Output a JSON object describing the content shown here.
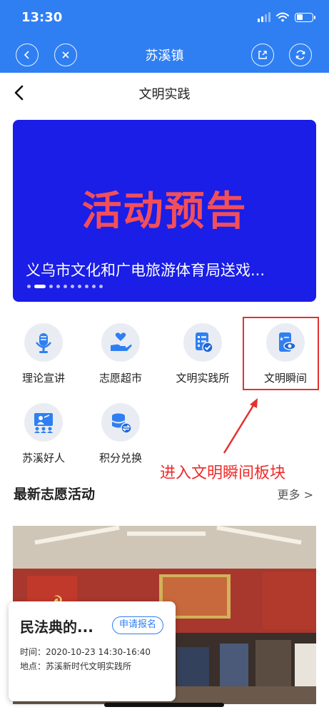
{
  "status_bar": {
    "time": "13:30"
  },
  "app_bar": {
    "title": "苏溪镇"
  },
  "page": {
    "title": "文明实践"
  },
  "banner": {
    "headline": "活动预告",
    "caption": "义乌市文化和广电旅游体育局送戏...",
    "slide_count": 10,
    "active_slide": 2
  },
  "features": [
    {
      "label": "理论宣讲",
      "icon": "microphone-icon"
    },
    {
      "label": "志愿超市",
      "icon": "heart-hand-icon"
    },
    {
      "label": "文明实践所",
      "icon": "checklist-icon"
    },
    {
      "label": "文明瞬间",
      "icon": "phone-eye-icon"
    },
    {
      "label": "苏溪好人",
      "icon": "presenter-icon"
    },
    {
      "label": "积分兑换",
      "icon": "coins-exchange-icon"
    }
  ],
  "annotation": {
    "text": "进入文明瞬间板块"
  },
  "section": {
    "title": "最新志愿活动",
    "more": "更多 >"
  },
  "activity": {
    "title": "民法典的...",
    "apply_label": "申请报名",
    "time": "时间：2020-10-23 14:30-16:40",
    "location": "地点：苏溪新时代文明实践所"
  },
  "colors": {
    "primary": "#2f7ff2",
    "banner_bg": "#1a1ee6",
    "banner_headline": "#f24f5a",
    "annotation": "#e53030"
  }
}
